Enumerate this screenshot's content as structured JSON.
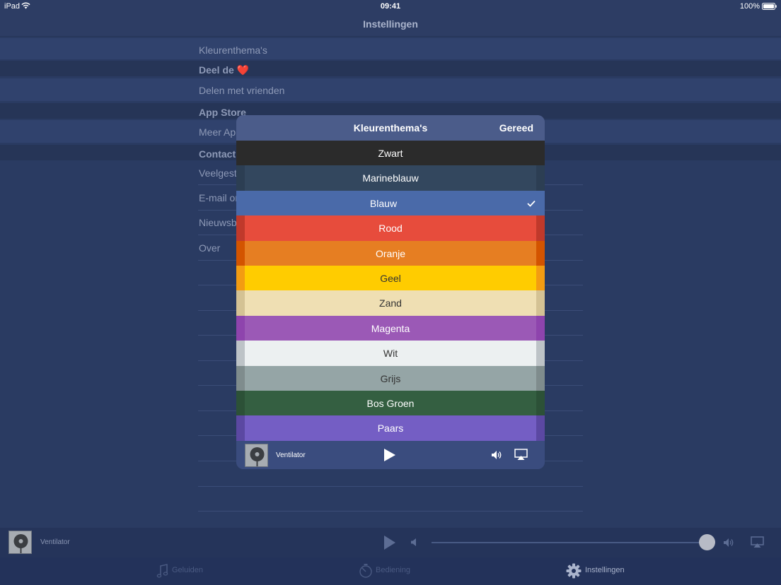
{
  "status_bar": {
    "device": "iPad",
    "time": "09:41",
    "battery": "100%"
  },
  "nav": {
    "title": "Instellingen"
  },
  "settings": {
    "rows": [
      {
        "label": "Kleurenthema's",
        "kind": "cell"
      },
      {
        "label": "Deel de ❤️",
        "kind": "header"
      },
      {
        "label": "Delen met vrienden",
        "kind": "cell"
      },
      {
        "label": "App Store",
        "kind": "header"
      },
      {
        "label": "Meer Ap",
        "kind": "cell"
      },
      {
        "label": "Contact",
        "kind": "header"
      },
      {
        "label": "Veelgest",
        "kind": "plain"
      },
      {
        "label": "E-mail or",
        "kind": "plain"
      },
      {
        "label": "Nieuwsb",
        "kind": "plain"
      },
      {
        "label": "Over",
        "kind": "plain"
      }
    ]
  },
  "modal": {
    "title": "Kleurenthema's",
    "done_label": "Gereed",
    "themes": [
      {
        "label": "Zwart",
        "bg": "#2b2b2b",
        "edge": "#2b2b2b",
        "text": "#ffffff",
        "selected": false
      },
      {
        "label": "Marineblauw",
        "bg": "#33475e",
        "edge": "#2c3e53",
        "text": "#ffffff",
        "selected": false
      },
      {
        "label": "Blauw",
        "bg": "#4a6aa9",
        "edge": "#4a6aa9",
        "text": "#ffffff",
        "selected": true
      },
      {
        "label": "Rood",
        "bg": "#e74c3c",
        "edge": "#c0392b",
        "text": "#ffffff",
        "selected": false
      },
      {
        "label": "Oranje",
        "bg": "#e67e22",
        "edge": "#d35400",
        "text": "#ffffff",
        "selected": false
      },
      {
        "label": "Geel",
        "bg": "#ffcc00",
        "edge": "#f39c12",
        "text": "#333333",
        "selected": false
      },
      {
        "label": "Zand",
        "bg": "#efdfb3",
        "edge": "#d4c294",
        "text": "#333333",
        "selected": false
      },
      {
        "label": "Magenta",
        "bg": "#9b59b6",
        "edge": "#8e44ad",
        "text": "#ffffff",
        "selected": false
      },
      {
        "label": "Wit",
        "bg": "#ecf0f1",
        "edge": "#bdc3c7",
        "text": "#333333",
        "selected": false
      },
      {
        "label": "Grijs",
        "bg": "#95a5a6",
        "edge": "#7f8c8d",
        "text": "#333333",
        "selected": false
      },
      {
        "label": "Bos Groen",
        "bg": "#345f41",
        "edge": "#2c5137",
        "text": "#ffffff",
        "selected": false
      },
      {
        "label": "Paars",
        "bg": "#745ec4",
        "edge": "#5b48a2",
        "text": "#ffffff",
        "selected": false
      }
    ],
    "player": {
      "track": "Ventilator"
    }
  },
  "bottom_player": {
    "track": "Ventilator",
    "volume_fraction": 1.0
  },
  "tabs": [
    {
      "label": "Geluiden",
      "icon": "music-note-icon",
      "active": false
    },
    {
      "label": "Bediening",
      "icon": "timer-icon",
      "active": false
    },
    {
      "label": "Instellingen",
      "icon": "gear-icon",
      "active": true
    }
  ],
  "colors": {
    "background": "#2a3b62",
    "accent_selected": "#4a6aa9",
    "tab_active": "#aab4cc",
    "tab_inactive": "#4a5a82"
  }
}
